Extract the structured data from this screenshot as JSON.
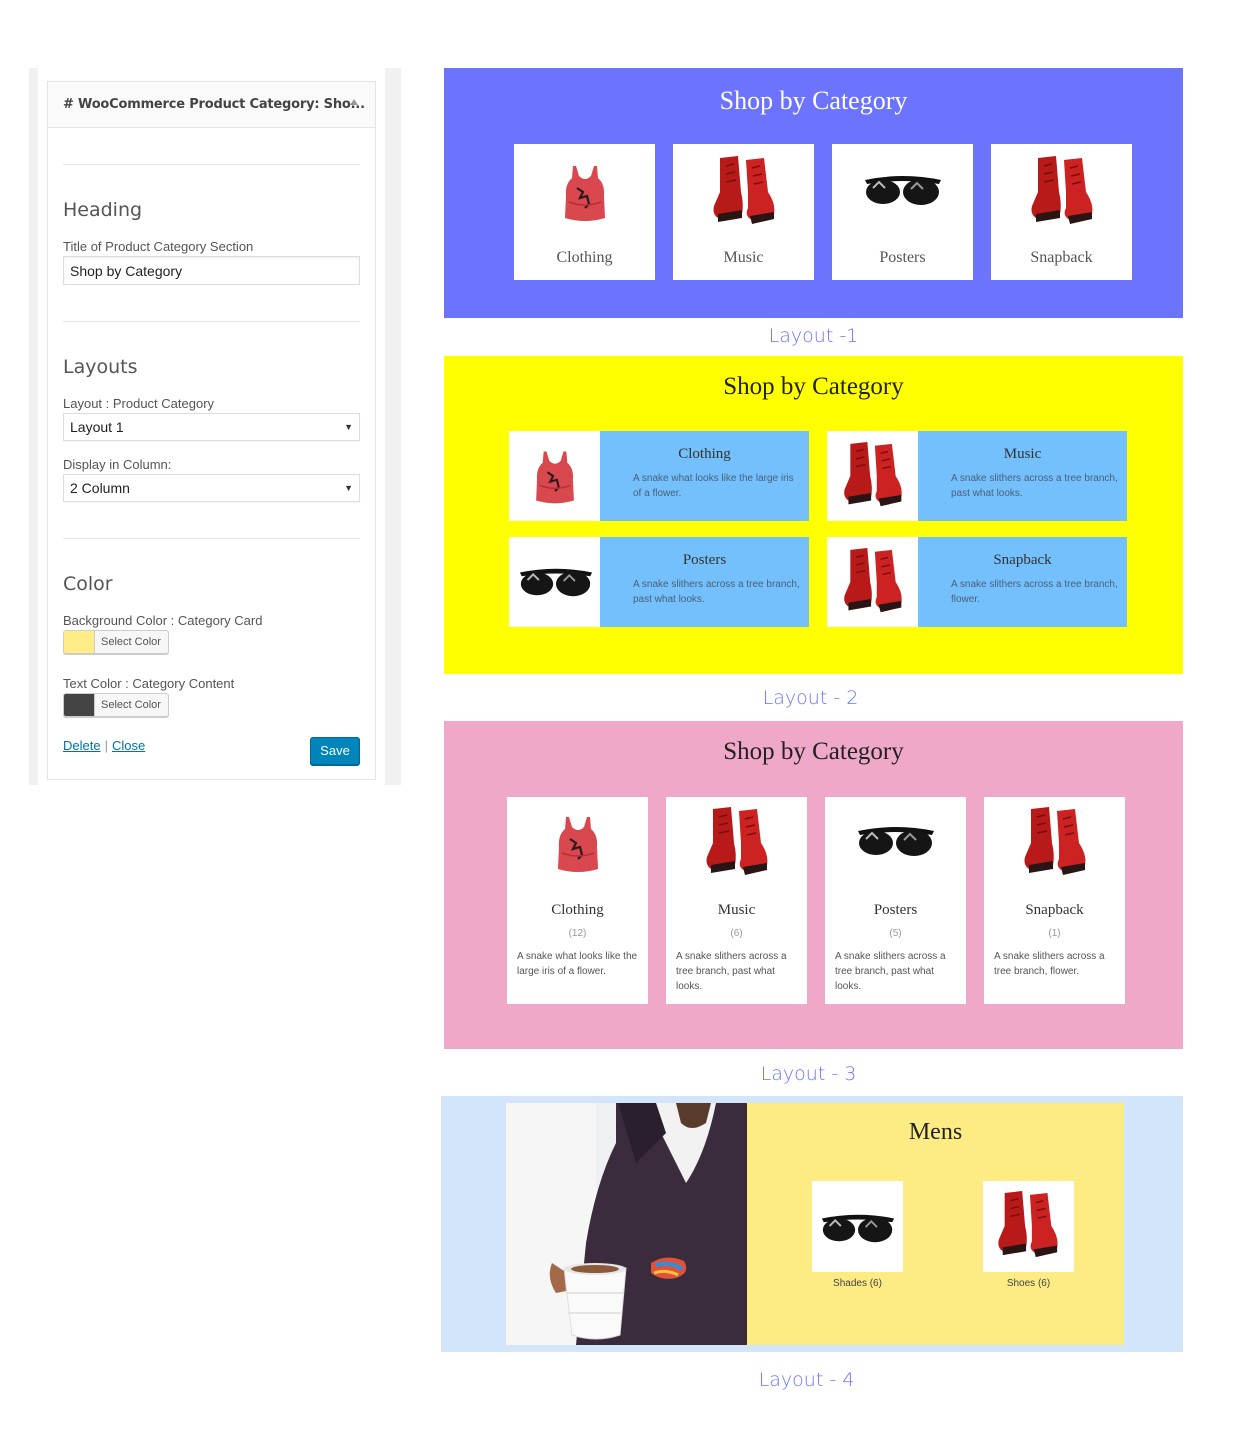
{
  "widget": {
    "title": "# WooCommerce Product Category: Sho...",
    "heading_section": "Heading",
    "title_label": "Title of Product Category Section",
    "title_value": "Shop by Category",
    "layouts_section": "Layouts",
    "layout_label": "Layout : Product Category",
    "layout_value": "Layout 1",
    "column_label": "Display in Column:",
    "column_value": "2 Column",
    "color_section": "Color",
    "bg_color_label": "Background Color : Category Card",
    "bg_color_value": "#ffee88",
    "text_color_label": "Text Color : Category Content",
    "text_color_value": "#444444",
    "select_color_label": "Select Color",
    "delete_label": "Delete",
    "close_label": "Close",
    "save_label": "Save"
  },
  "previews": {
    "title": "Shop by Category",
    "layout1": {
      "caption": "Layout -1",
      "background": "#6b73ff",
      "cards": [
        {
          "name": "Clothing",
          "icon": "tank-top-icon"
        },
        {
          "name": "Music",
          "icon": "boots-icon"
        },
        {
          "name": "Posters",
          "icon": "sunglasses-icon"
        },
        {
          "name": "Snapback",
          "icon": "boots-icon"
        }
      ]
    },
    "layout2": {
      "caption": "Layout - 2",
      "background": "#ffff00",
      "cards": [
        {
          "name": "Clothing",
          "desc": "A snake what looks like the large iris of a flower.",
          "icon": "tank-top-icon"
        },
        {
          "name": "Music",
          "desc": "A snake slithers across a tree branch, past what looks.",
          "icon": "boots-icon"
        },
        {
          "name": "Posters",
          "desc": "A snake slithers across a tree branch, past what looks.",
          "icon": "sunglasses-icon"
        },
        {
          "name": "Snapback",
          "desc": "A snake slithers across a tree branch, flower.",
          "icon": "boots-icon"
        }
      ]
    },
    "layout3": {
      "caption": "Layout - 3",
      "background": "#f0a8c9",
      "cards": [
        {
          "name": "Clothing",
          "count": "(12)",
          "desc": "A snake what looks like the large iris of a flower.",
          "icon": "tank-top-icon"
        },
        {
          "name": "Music",
          "count": "(6)",
          "desc": "A snake slithers across a tree branch, past what looks.",
          "icon": "boots-icon"
        },
        {
          "name": "Posters",
          "count": "(5)",
          "desc": "A snake slithers across a tree branch, past what looks.",
          "icon": "sunglasses-icon"
        },
        {
          "name": "Snapback",
          "count": "(1)",
          "desc": "A snake slithers across a tree branch, flower.",
          "icon": "boots-icon"
        }
      ]
    },
    "layout4": {
      "caption": "Layout - 4",
      "background": "#d2e5fb",
      "panel_title": "Mens",
      "items": [
        {
          "name": "Shades (6)",
          "icon": "sunglasses-icon"
        },
        {
          "name": "Shoes (6)",
          "icon": "boots-icon"
        }
      ]
    }
  }
}
